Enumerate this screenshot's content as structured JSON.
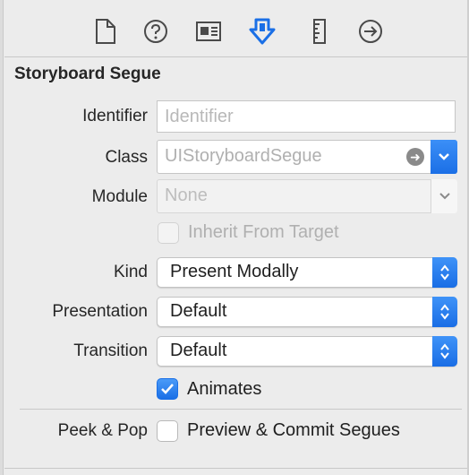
{
  "colors": {
    "accent": "#1a6fe6",
    "panel_bg": "#ececec",
    "icon_gray": "#4a4a4a"
  },
  "tabs": [
    {
      "name": "file-inspector",
      "icon": "file-icon"
    },
    {
      "name": "quick-help",
      "icon": "question-icon"
    },
    {
      "name": "identity-inspector",
      "icon": "identity-card-icon"
    },
    {
      "name": "attributes-inspector",
      "icon": "attributes-down-arrow-icon",
      "selected": true
    },
    {
      "name": "size-inspector",
      "icon": "ruler-icon"
    },
    {
      "name": "connections-inspector",
      "icon": "arrow-right-circle-icon"
    }
  ],
  "section": {
    "title": "Storyboard Segue"
  },
  "identifier": {
    "label": "Identifier",
    "placeholder": "Identifier"
  },
  "class_field": {
    "label": "Class",
    "placeholder": "UIStoryboardSegue"
  },
  "module": {
    "label": "Module",
    "placeholder": "None"
  },
  "inherit": {
    "label": "Inherit From Target",
    "checked": false,
    "enabled": false
  },
  "kind": {
    "label": "Kind",
    "value": "Present Modally"
  },
  "presentation": {
    "label": "Presentation",
    "value": "Default"
  },
  "transition": {
    "label": "Transition",
    "value": "Default"
  },
  "animates": {
    "label": "Animates",
    "checked": true
  },
  "peek_pop": {
    "label": "Peek & Pop",
    "option_label": "Preview & Commit Segues",
    "checked": false
  }
}
